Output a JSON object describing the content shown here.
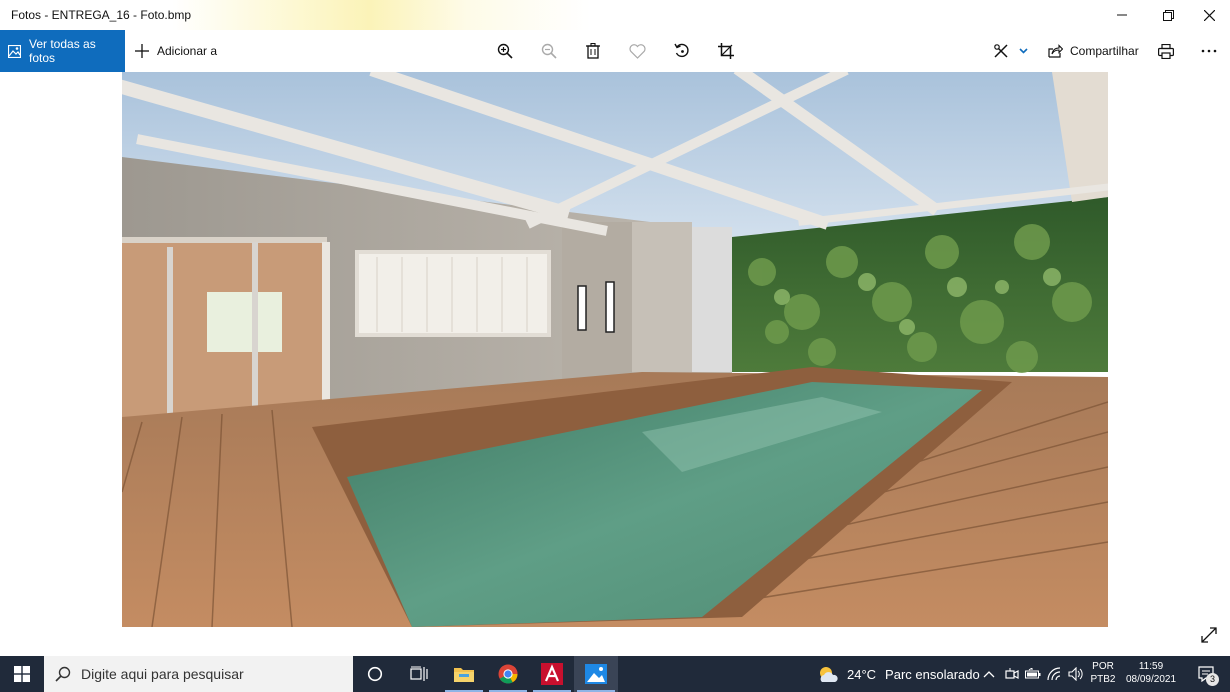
{
  "window": {
    "title": "Fotos - ENTREGA_16 - Foto.bmp",
    "minimize_icon": "minimize-icon",
    "restore_icon": "restore-icon",
    "close_icon": "close-icon"
  },
  "toolbar": {
    "see_all_label": "Ver todas as fotos",
    "add_to_label": "Adicionar a",
    "share_label": "Compartilhar",
    "icons": [
      "zoom-in-icon",
      "zoom-out-icon",
      "delete-icon",
      "favorite-icon",
      "rotate-icon",
      "crop-icon",
      "edit-draw-icon",
      "print-icon",
      "more-icon"
    ]
  },
  "photo": {
    "description_icon": "photo-pool-deck",
    "expand_icon": "expand-icon"
  },
  "taskbar": {
    "search_placeholder": "Digite aqui para pesquisar",
    "weather_temp": "24°C",
    "weather_text": "Parc ensolarado",
    "lang_line1": "POR",
    "lang_line2": "PTB2",
    "time": "11:59",
    "date": "08/09/2021",
    "notification_count": "3"
  },
  "colors": {
    "accent": "#0f6cbd",
    "taskbar": "#202a3a",
    "title_text": "#111111"
  }
}
